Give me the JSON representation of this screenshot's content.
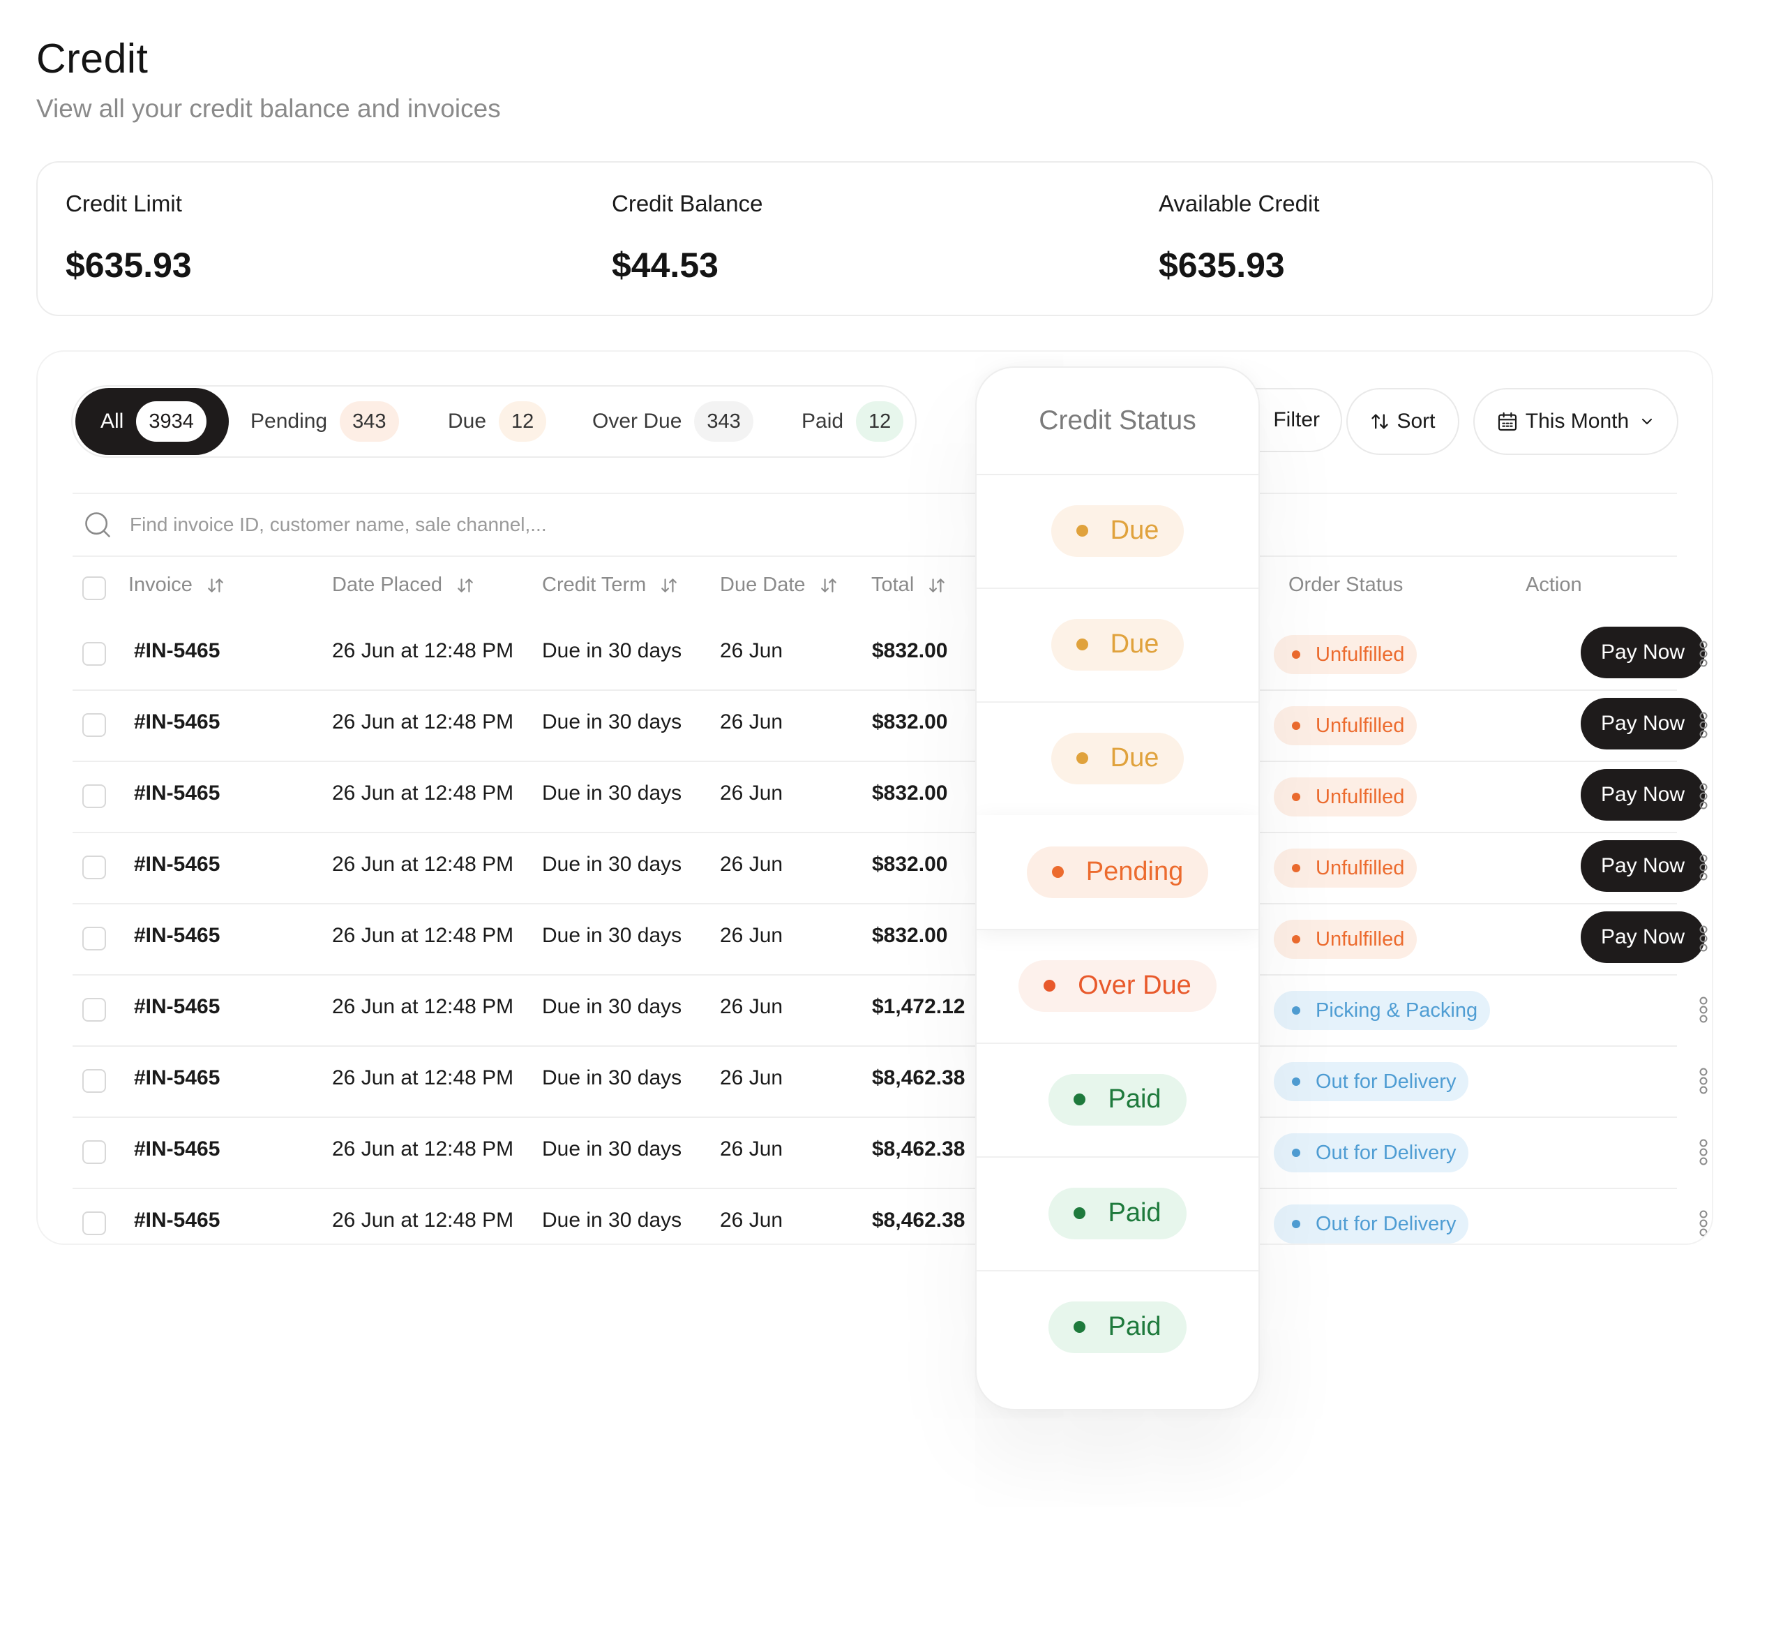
{
  "page": {
    "title": "Credit",
    "subtitle": "View all your credit balance and invoices"
  },
  "summary": [
    {
      "label": "Credit Limit",
      "value": "$635.93"
    },
    {
      "label": "Credit Balance",
      "value": "$44.53"
    },
    {
      "label": "Available Credit",
      "value": "$635.93"
    }
  ],
  "tabs": [
    {
      "label": "All",
      "count": "3934",
      "active": true
    },
    {
      "label": "Pending",
      "count": "343",
      "color": "#fdeee5"
    },
    {
      "label": "Due",
      "count": "12",
      "color": "#fdf2e7"
    },
    {
      "label": "Over Due",
      "count": "343",
      "color": "#f3f3f3"
    },
    {
      "label": "Paid",
      "count": "12",
      "color": "#e7f6ec"
    }
  ],
  "toolbar": {
    "filter_label": "Filter",
    "sort_label": "Sort",
    "period_label": "This Month"
  },
  "search": {
    "placeholder": "Find invoice ID, customer name, sale channel,..."
  },
  "columns": {
    "invoice": "Invoice",
    "date_placed": "Date Placed",
    "credit_term": "Credit Term",
    "due_date": "Due Date",
    "total": "Total",
    "order_status": "Order Status",
    "action": "Action"
  },
  "rows": [
    {
      "invoice": "#IN-5465",
      "date_placed": "26 Jun at 12:48 PM",
      "credit_term": "Due in 30 days",
      "due_date": "26 Jun",
      "total": "$832.00",
      "order_status": "Unfulfilled",
      "status_type": "unfulfilled",
      "action": "Pay Now"
    },
    {
      "invoice": "#IN-5465",
      "date_placed": "26 Jun at 12:48 PM",
      "credit_term": "Due in 30 days",
      "due_date": "26 Jun",
      "total": "$832.00",
      "order_status": "Unfulfilled",
      "status_type": "unfulfilled",
      "action": "Pay Now"
    },
    {
      "invoice": "#IN-5465",
      "date_placed": "26 Jun at 12:48 PM",
      "credit_term": "Due in 30 days",
      "due_date": "26 Jun",
      "total": "$832.00",
      "order_status": "Unfulfilled",
      "status_type": "unfulfilled",
      "action": "Pay Now"
    },
    {
      "invoice": "#IN-5465",
      "date_placed": "26 Jun at 12:48 PM",
      "credit_term": "Due in 30 days",
      "due_date": "26 Jun",
      "total": "$832.00",
      "order_status": "Unfulfilled",
      "status_type": "unfulfilled",
      "action": "Pay Now"
    },
    {
      "invoice": "#IN-5465",
      "date_placed": "26 Jun at 12:48 PM",
      "credit_term": "Due in 30 days",
      "due_date": "26 Jun",
      "total": "$832.00",
      "order_status": "Unfulfilled",
      "status_type": "unfulfilled",
      "action": "Pay Now"
    },
    {
      "invoice": "#IN-5465",
      "date_placed": "26 Jun at 12:48 PM",
      "credit_term": "Due in 30 days",
      "due_date": "26 Jun",
      "total": "$1,472.12",
      "order_status": "Picking & Packing",
      "status_type": "picking",
      "action": ""
    },
    {
      "invoice": "#IN-5465",
      "date_placed": "26 Jun at 12:48 PM",
      "credit_term": "Due in 30 days",
      "due_date": "26 Jun",
      "total": "$8,462.38",
      "order_status": "Out for Delivery",
      "status_type": "picking",
      "action": ""
    },
    {
      "invoice": "#IN-5465",
      "date_placed": "26 Jun at 12:48 PM",
      "credit_term": "Due in 30 days",
      "due_date": "26 Jun",
      "total": "$8,462.38",
      "order_status": "Out for Delivery",
      "status_type": "picking",
      "action": ""
    },
    {
      "invoice": "#IN-5465",
      "date_placed": "26 Jun at 12:48 PM",
      "credit_term": "Due in 30 days",
      "due_date": "26 Jun",
      "total": "$8,462.38",
      "order_status": "Out for Delivery",
      "status_type": "picking",
      "action": ""
    }
  ],
  "credit_status_popup": {
    "title": "Credit Status",
    "items": [
      {
        "label": "Due",
        "type": "due"
      },
      {
        "label": "Due",
        "type": "due"
      },
      {
        "label": "Due",
        "type": "due"
      },
      {
        "label": "Pending",
        "type": "pending"
      },
      {
        "label": "Over Due",
        "type": "overdue"
      },
      {
        "label": "Paid",
        "type": "paid"
      },
      {
        "label": "Paid",
        "type": "paid"
      },
      {
        "label": "Paid",
        "type": "paid"
      }
    ]
  },
  "colors": {
    "primary_dark": "#1e1b1b",
    "unfulfilled": "#ec6b2e",
    "picking": "#4f9dd3",
    "due": "#e0a23c",
    "paid": "#1e7a3c"
  }
}
